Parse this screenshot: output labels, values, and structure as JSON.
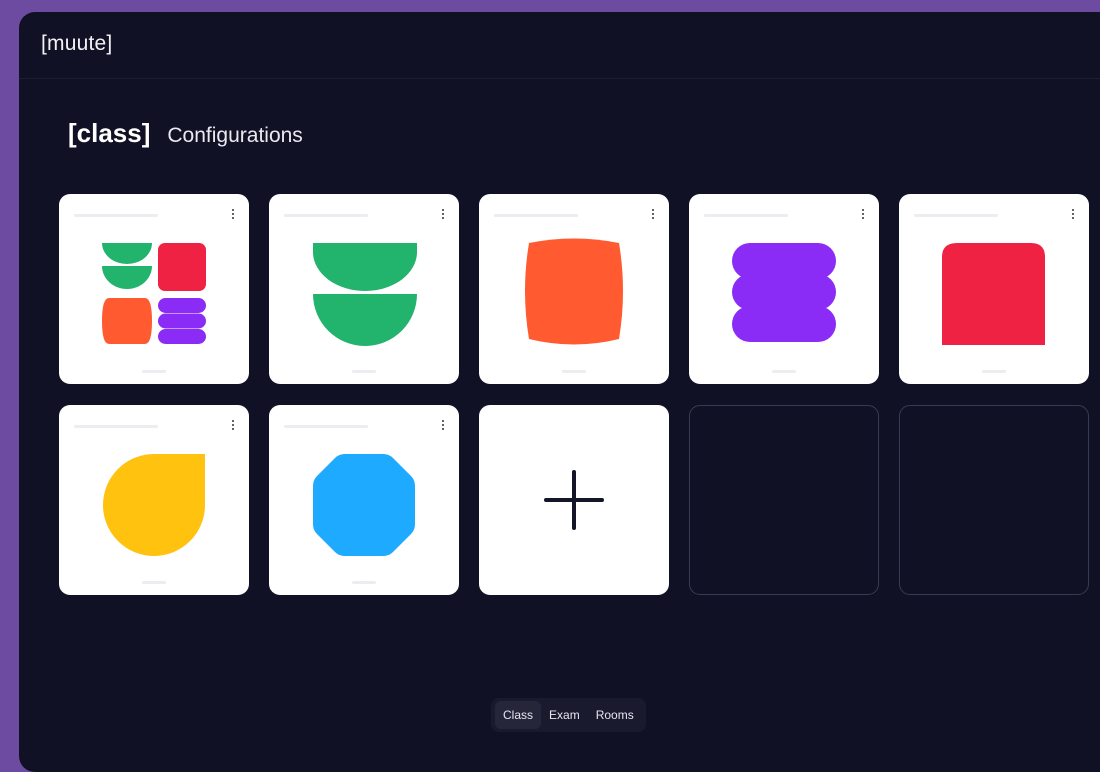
{
  "app": {
    "logo": "[muute]"
  },
  "header": {
    "tag": "[class]",
    "title": "Configurations"
  },
  "colors": {
    "background": "#6d4ba0",
    "window": "#111125",
    "green": "#22b36c",
    "red": "#f02244",
    "orange": "#ff5a30",
    "purple": "#8a2cf5",
    "yellow": "#ffc20e",
    "blue": "#1eaaff"
  },
  "tiles": [
    {
      "type": "configuration",
      "icon": "mixed-shapes-icon"
    },
    {
      "type": "configuration",
      "icon": "green-half-circles-icon"
    },
    {
      "type": "configuration",
      "icon": "orange-barrel-icon"
    },
    {
      "type": "configuration",
      "icon": "purple-stack-icon"
    },
    {
      "type": "configuration",
      "icon": "red-square-icon"
    },
    {
      "type": "configuration",
      "icon": "yellow-drop-icon"
    },
    {
      "type": "configuration",
      "icon": "blue-octagon-icon"
    },
    {
      "type": "add",
      "icon": "plus-icon"
    },
    {
      "type": "empty"
    },
    {
      "type": "empty"
    }
  ],
  "tabs": [
    {
      "label": "Class",
      "active": true
    },
    {
      "label": "Exam",
      "active": false
    },
    {
      "label": "Rooms",
      "active": false
    }
  ]
}
